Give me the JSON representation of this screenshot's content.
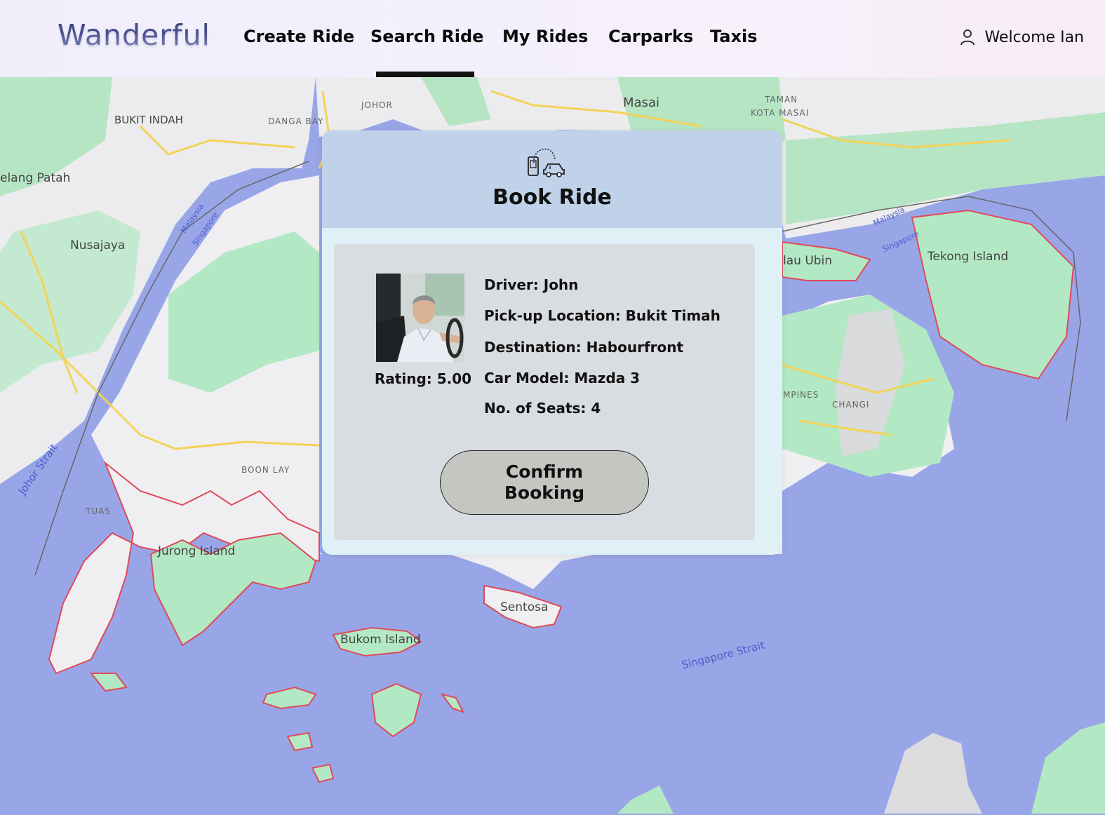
{
  "header": {
    "logo": "Wanderful",
    "nav": [
      {
        "label": "Create Ride"
      },
      {
        "label": "Search Ride"
      },
      {
        "label": "My Rides"
      },
      {
        "label": "Carparks"
      },
      {
        "label": "Taxis"
      }
    ],
    "active_nav": "Search Ride",
    "welcome": "Welcome Ian",
    "user_icon": "user-icon"
  },
  "map": {
    "labels": {
      "bukit_indah": "BUKIT INDAH",
      "danga_bay": "DANGA BAY",
      "johor": "JOHOR",
      "masai": "Masai",
      "taman_kota_masai_1": "TAMAN",
      "taman_kota_masai_2": "KOTA MASAI",
      "gelang_patah": "elang Patah",
      "nusajaya": "Nusajaya",
      "pulau_ubin": "lau Ubin",
      "tekong": "Tekong Island",
      "tampines": "MPINES",
      "changi": "CHANGI",
      "boon_lay": "BOON LAY",
      "tuas": "TUAS",
      "jurong_island": "Jurong Island",
      "sentosa": "Sentosa",
      "bukom": "Bukom Island",
      "johor_strait": "Johor Strait",
      "singapore_strait": "Singapore Strait",
      "malaysia_w": "Malaysia",
      "singapore_w": "Singapore",
      "malaysia_e": "Malaysia",
      "singapore_e": "Singapore"
    },
    "colors": {
      "water": "#98a6e8",
      "land": "#f0f0f2",
      "green": "#b3e8c4",
      "road": "#f3d356",
      "border": "#e0495a"
    }
  },
  "booking": {
    "title": "Book Ride",
    "icon": "ride-booking-icon",
    "driver_photo": "driver-photo",
    "rating": "Rating: 5.00",
    "details": {
      "driver": "Driver: John",
      "pickup": "Pick-up Location: Bukit Timah",
      "destination": "Destination: Habourfront",
      "car_model": "Car Model: Mazda 3",
      "seats": "No. of Seats: 4"
    },
    "confirm_label": "Confirm Booking"
  }
}
